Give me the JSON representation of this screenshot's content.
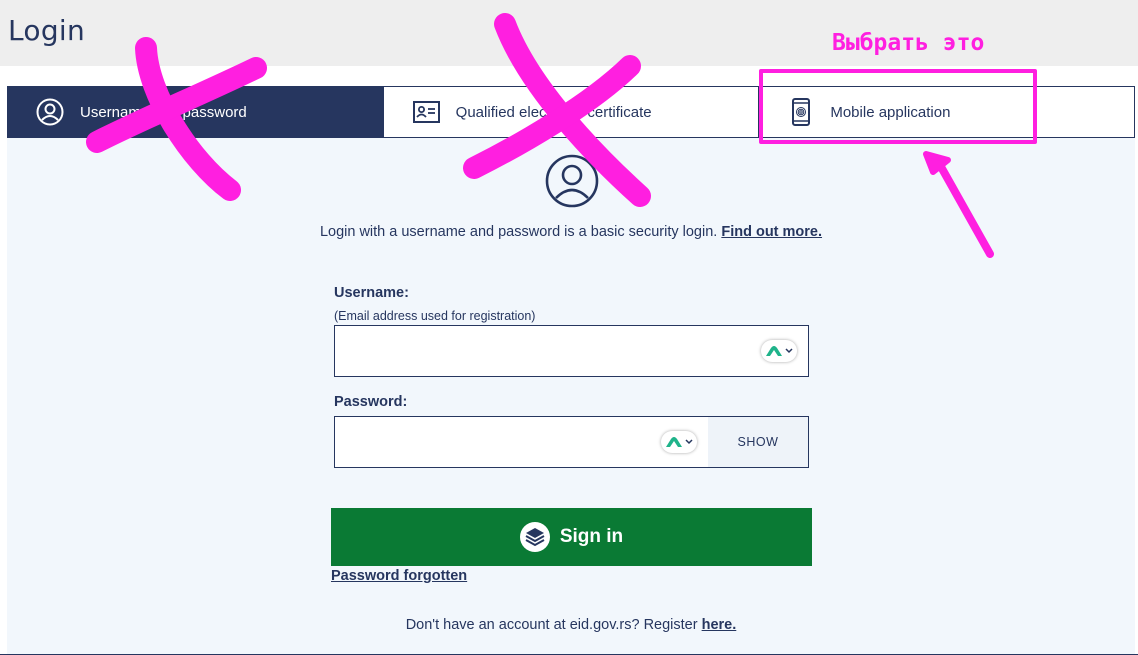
{
  "page": {
    "title": "Login"
  },
  "annotation": {
    "label": "Выбрать это",
    "color": "#ff1fe0"
  },
  "tabs": [
    {
      "label": "Username and password",
      "icon": "user-circle-icon",
      "active": true
    },
    {
      "label": "Qualified electronic certificate",
      "icon": "id-card-icon",
      "active": false
    },
    {
      "label": "Mobile application",
      "icon": "mobile-fingerprint-icon",
      "active": false
    }
  ],
  "intro": {
    "text": "Login with a username and password is a basic security login.",
    "link": "Find out more."
  },
  "username": {
    "label": "Username:",
    "hint": "(Email address used for registration)",
    "value": "",
    "placeholder": ""
  },
  "password": {
    "label": "Password:",
    "value": "",
    "placeholder": "",
    "show_label": "SHOW"
  },
  "signin": {
    "label": "Sign in"
  },
  "forgot": {
    "label": "Password forgotten"
  },
  "register": {
    "text": "Don't have an account at eid.gov.rs? Register",
    "link": "here."
  },
  "colors": {
    "primary": "#26365f",
    "success": "#0a7a34",
    "content_bg": "#f2f7fc",
    "header_bg": "#eeeeee",
    "password_manager": "#1fb38a"
  }
}
